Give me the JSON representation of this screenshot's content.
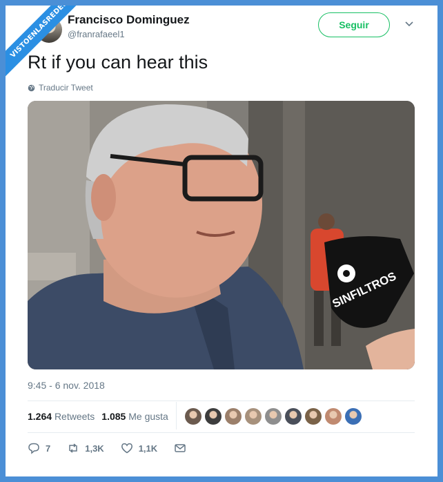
{
  "watermark": "VISTOENLASREDES",
  "header": {
    "name": "Francisco Dominguez",
    "handle": "@franrafaeel1",
    "follow_label": "Seguir"
  },
  "tweet": {
    "text": "Rt if you can hear this",
    "translate_label": "Traducir Tweet",
    "timestamp": "9:45 - 6 nov. 2018"
  },
  "media": {
    "mic_flag_text": "SINFILTROS"
  },
  "stats": {
    "retweets_count": "1.264",
    "retweets_label": "Retweets",
    "likes_count": "1.085",
    "likes_label": "Me gusta",
    "liker_avatar_colors": [
      "#6b5a4e",
      "#3d3d3d",
      "#9b7f6a",
      "#a7917c",
      "#8e8e8e",
      "#4a4f5a",
      "#7a6248",
      "#c08a70",
      "#3b6fb5"
    ]
  },
  "actions": {
    "reply_count": "7",
    "retweet_count": "1,3K",
    "like_count": "1,1K"
  },
  "colors": {
    "follow_green": "#17bf63",
    "watermark_blue": "#2b8fe3",
    "muted_text": "#657786"
  }
}
